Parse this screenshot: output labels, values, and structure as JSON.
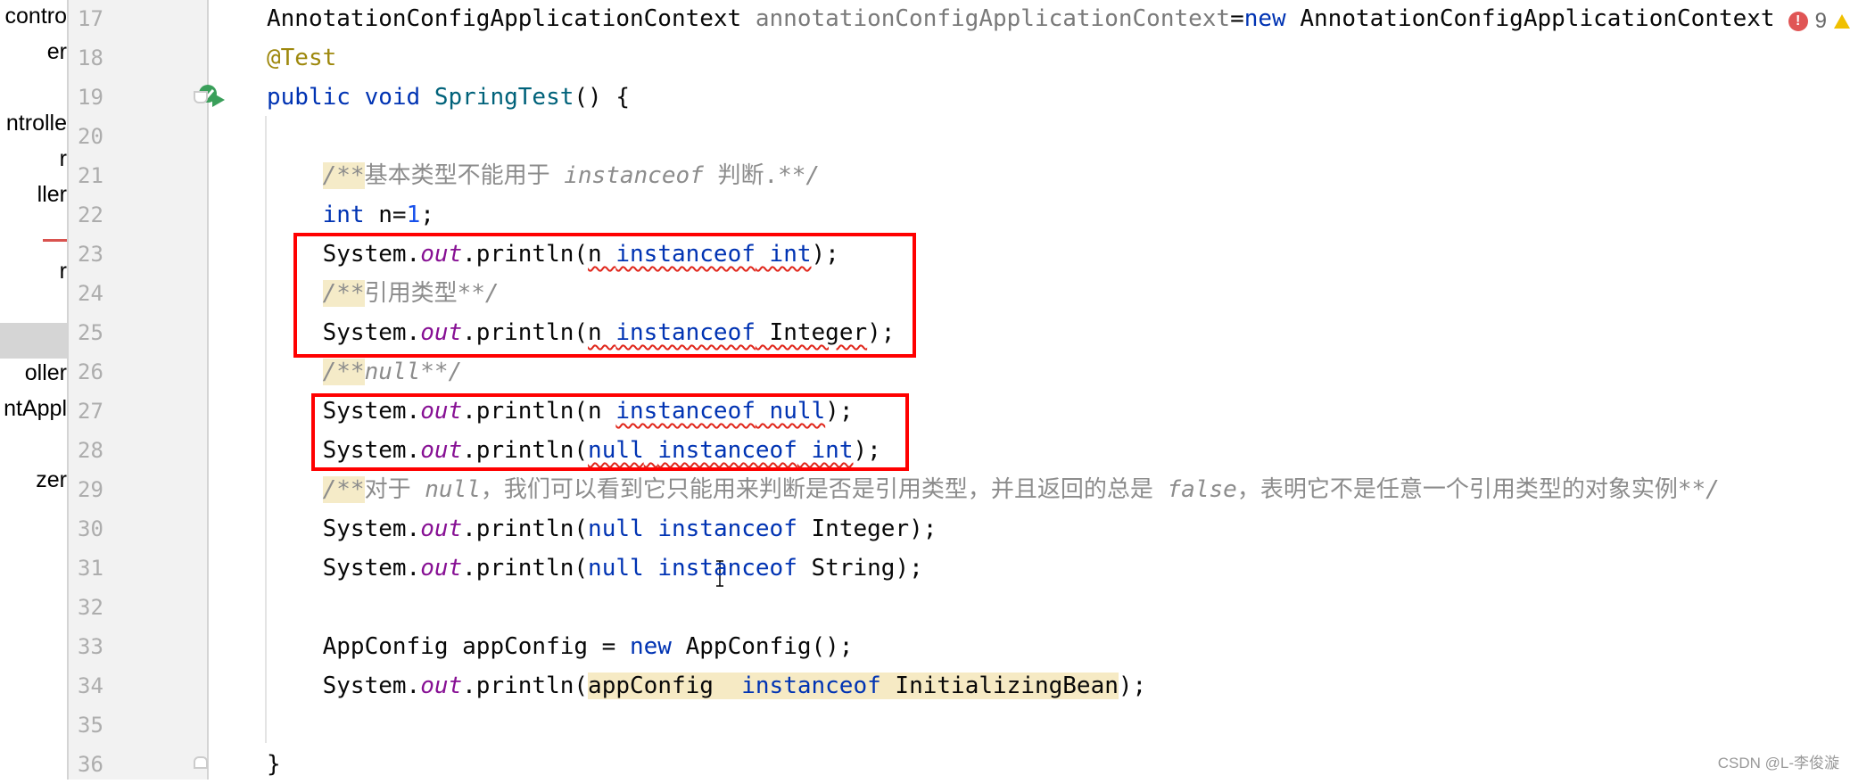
{
  "sidebar": {
    "items": [
      {
        "label": "contro",
        "top": 0
      },
      {
        "label": "er",
        "top": 0
      },
      {
        "label": "ntrolle",
        "top": 0
      },
      {
        "label": "r",
        "top": 0
      },
      {
        "label": "ller",
        "top": 0
      },
      {
        "label": "r",
        "top": 0
      },
      {
        "label": "oller",
        "top": 0
      },
      {
        "label": "ntAppl",
        "top": 0
      },
      {
        "label": "zer",
        "top": 0
      }
    ]
  },
  "gutter": {
    "line_numbers": [
      "17",
      "18",
      "19",
      "20",
      "21",
      "22",
      "23",
      "24",
      "25",
      "26",
      "27",
      "28",
      "29",
      "30",
      "31",
      "32",
      "33",
      "34",
      "35",
      "36"
    ],
    "run_icon": "run-test-icon"
  },
  "problems": {
    "error_count": "9",
    "error_icon": "error-icon",
    "warning_icon": "warning-icon"
  },
  "code": [
    [
      [
        "AnnotationConfigApplicationContext ",
        ""
      ],
      [
        "annotationConfigApplicationContext",
        "unused"
      ],
      [
        "=",
        ""
      ],
      [
        "new",
        "kw"
      ],
      [
        " AnnotationConfigApplicationContext",
        ""
      ]
    ],
    [
      [
        "@Test",
        "ann"
      ]
    ],
    [
      [
        "public",
        "kw"
      ],
      [
        " ",
        ""
      ],
      [
        "void",
        "kw"
      ],
      [
        " ",
        ""
      ],
      [
        "SpringTest",
        "mth"
      ],
      [
        "() {",
        ""
      ]
    ],
    [],
    [
      [
        "    ",
        ""
      ],
      [
        "/**",
        "cmk"
      ],
      [
        "基本类型不能用于 ",
        "cmz"
      ],
      [
        "instanceof",
        "cm"
      ],
      [
        " 判断.",
        "cmz"
      ],
      [
        "**/",
        "cm"
      ]
    ],
    [
      [
        "    ",
        ""
      ],
      [
        "int",
        "kw"
      ],
      [
        " n=",
        ""
      ],
      [
        "1",
        "num"
      ],
      [
        ";",
        ""
      ]
    ],
    [
      [
        "    System.",
        ""
      ],
      [
        "out",
        "fld"
      ],
      [
        ".println(",
        ""
      ],
      [
        "n ",
        "err"
      ],
      [
        "instanceof",
        "kw err"
      ],
      [
        " int",
        "kw err"
      ],
      [
        ");",
        ""
      ]
    ],
    [
      [
        "    ",
        ""
      ],
      [
        "/**",
        "cmk"
      ],
      [
        "引用类型",
        "cmz"
      ],
      [
        "**/",
        "cm"
      ]
    ],
    [
      [
        "    System.",
        ""
      ],
      [
        "out",
        "fld"
      ],
      [
        ".println(",
        ""
      ],
      [
        "n ",
        "err"
      ],
      [
        "instanceof",
        "kw err"
      ],
      [
        " Integer",
        "err"
      ],
      [
        ");",
        ""
      ]
    ],
    [
      [
        "    ",
        ""
      ],
      [
        "/**",
        "cmk"
      ],
      [
        "null**/",
        "cm"
      ]
    ],
    [
      [
        "    System.",
        ""
      ],
      [
        "out",
        "fld"
      ],
      [
        ".println(n ",
        ""
      ],
      [
        "instanceof",
        "kw err"
      ],
      [
        " null",
        "kw err"
      ],
      [
        ");",
        ""
      ]
    ],
    [
      [
        "    System.",
        ""
      ],
      [
        "out",
        "fld"
      ],
      [
        ".println(",
        ""
      ],
      [
        "null",
        "kw err"
      ],
      [
        " ",
        "err"
      ],
      [
        "instanceof",
        "kw err"
      ],
      [
        " int",
        "kw err"
      ],
      [
        ");",
        ""
      ]
    ],
    [
      [
        "    ",
        ""
      ],
      [
        "/**",
        "cmk"
      ],
      [
        "对于 ",
        "cmz"
      ],
      [
        "null",
        "cm"
      ],
      [
        "，我们可以看到它只能用来判断是否是引用类型，并且返回的总是 ",
        "cmz"
      ],
      [
        "false",
        "cm"
      ],
      [
        "，表明它不是任意一个引用类型的对象实例",
        "cmz"
      ],
      [
        "**/",
        "cm"
      ]
    ],
    [
      [
        "    System.",
        ""
      ],
      [
        "out",
        "fld"
      ],
      [
        ".println(",
        ""
      ],
      [
        "null",
        "kw"
      ],
      [
        " ",
        ""
      ],
      [
        "instanceof",
        "kw"
      ],
      [
        " Integer);",
        ""
      ]
    ],
    [
      [
        "    System.",
        ""
      ],
      [
        "out",
        "fld"
      ],
      [
        ".println(",
        ""
      ],
      [
        "null",
        "kw"
      ],
      [
        " ",
        ""
      ],
      [
        "instanceof",
        "kw"
      ],
      [
        " String);",
        ""
      ]
    ],
    [],
    [
      [
        "    AppConfig appConfig = ",
        ""
      ],
      [
        "new",
        "kw"
      ],
      [
        " AppConfig();",
        ""
      ]
    ],
    [
      [
        "    System.",
        ""
      ],
      [
        "out",
        "fld"
      ],
      [
        ".println(",
        ""
      ],
      [
        "appConfig  ",
        "hl"
      ],
      [
        "instanceof",
        "kw hl"
      ],
      [
        " InitializingBean",
        "hl"
      ],
      [
        ");",
        ""
      ]
    ],
    [],
    [
      [
        "}",
        ""
      ]
    ]
  ],
  "watermark": "CSDN @L-李俊漩"
}
